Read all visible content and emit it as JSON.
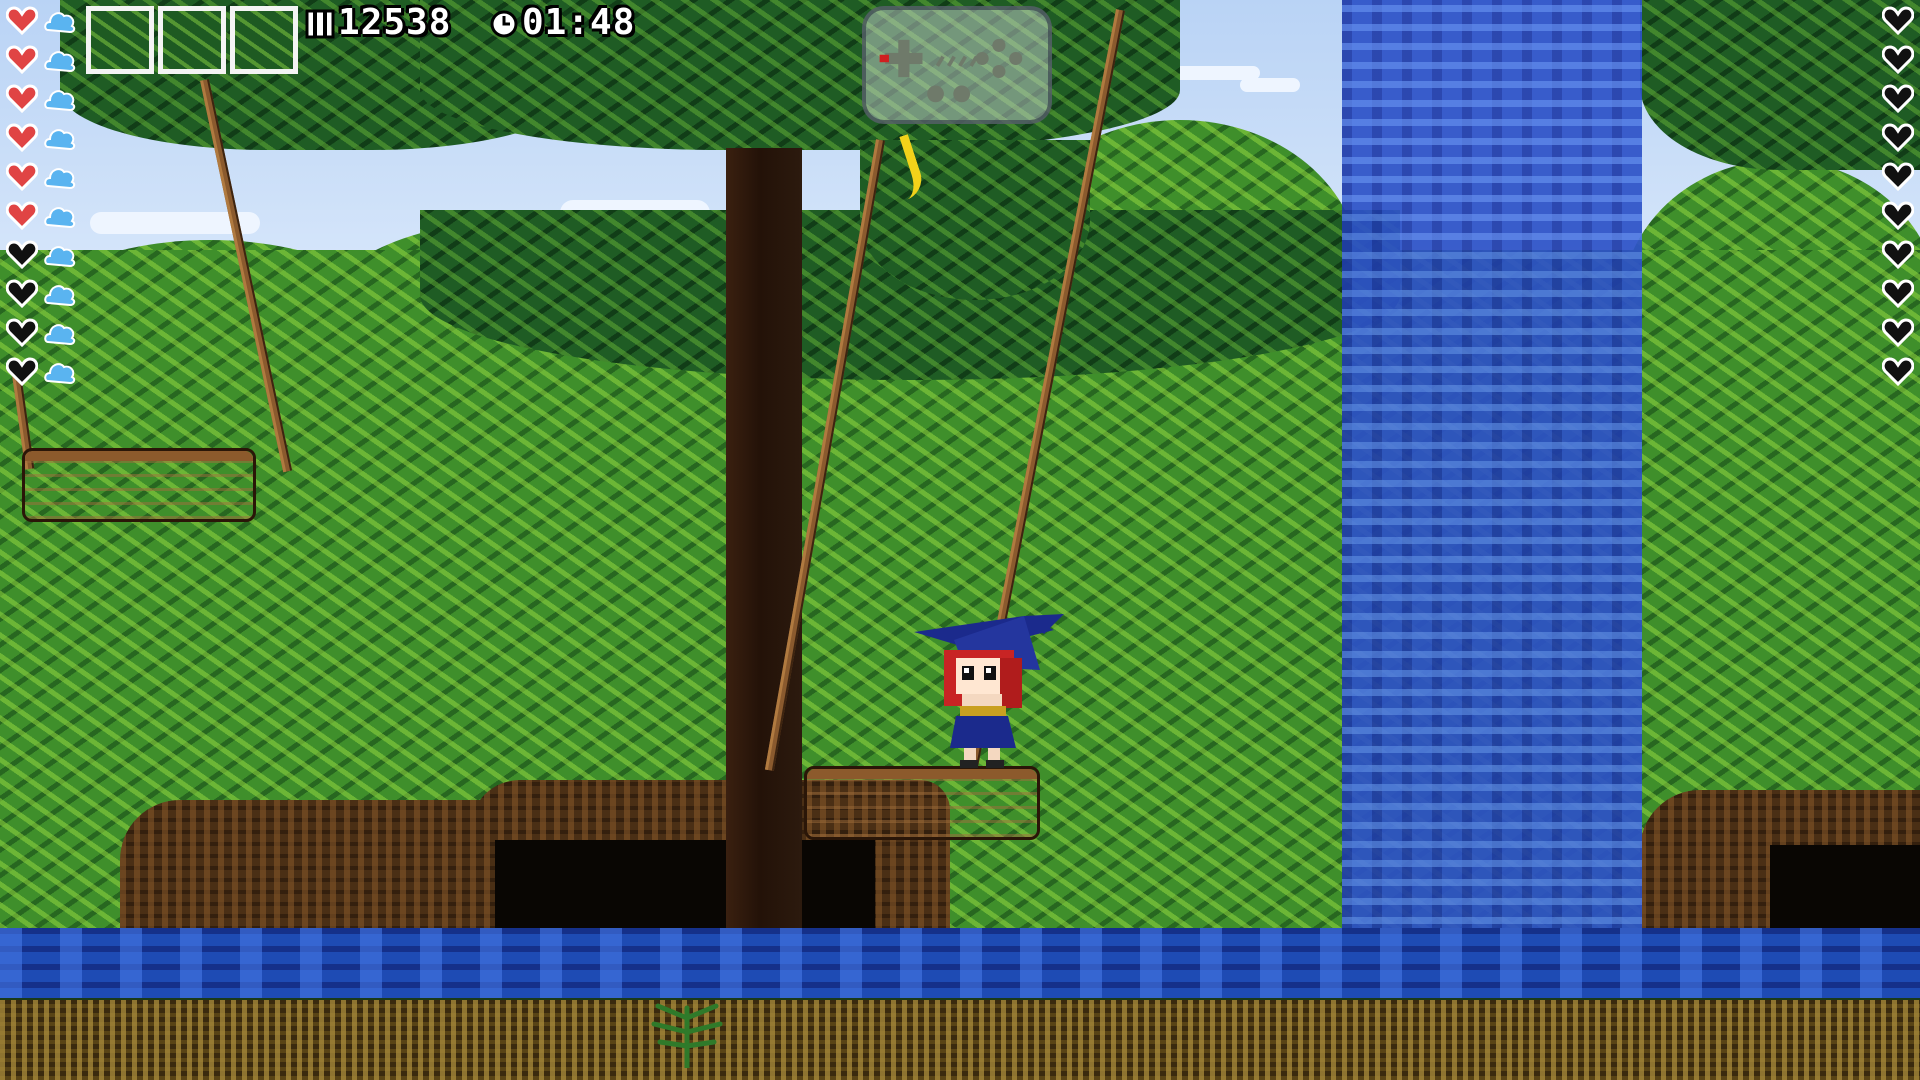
{
  "game": {
    "scene": "jungle-waterfall-level"
  },
  "hud": {
    "health": {
      "current": 6,
      "max": 10
    },
    "mana": {
      "current": 10,
      "max": 10
    },
    "item_slots": [
      {
        "icon": "empty-slot"
      },
      {
        "icon": "empty-slot"
      },
      {
        "icon": "empty-slot"
      }
    ],
    "coins": {
      "icon": "coin-icon",
      "value": "12538"
    },
    "timer": {
      "icon": "clock-icon",
      "value": "01:48"
    },
    "boss_health": {
      "current": 0,
      "max": 10
    },
    "controller_indicator": {
      "icon": "gamepad-icon"
    }
  },
  "colors": {
    "heart_full": "#e04444",
    "heart_empty": "#111111",
    "mana": "#5ab4f0",
    "hud_text": "#ffffff",
    "waterfall": "#2d52c8",
    "river": "#1e4bb4"
  }
}
